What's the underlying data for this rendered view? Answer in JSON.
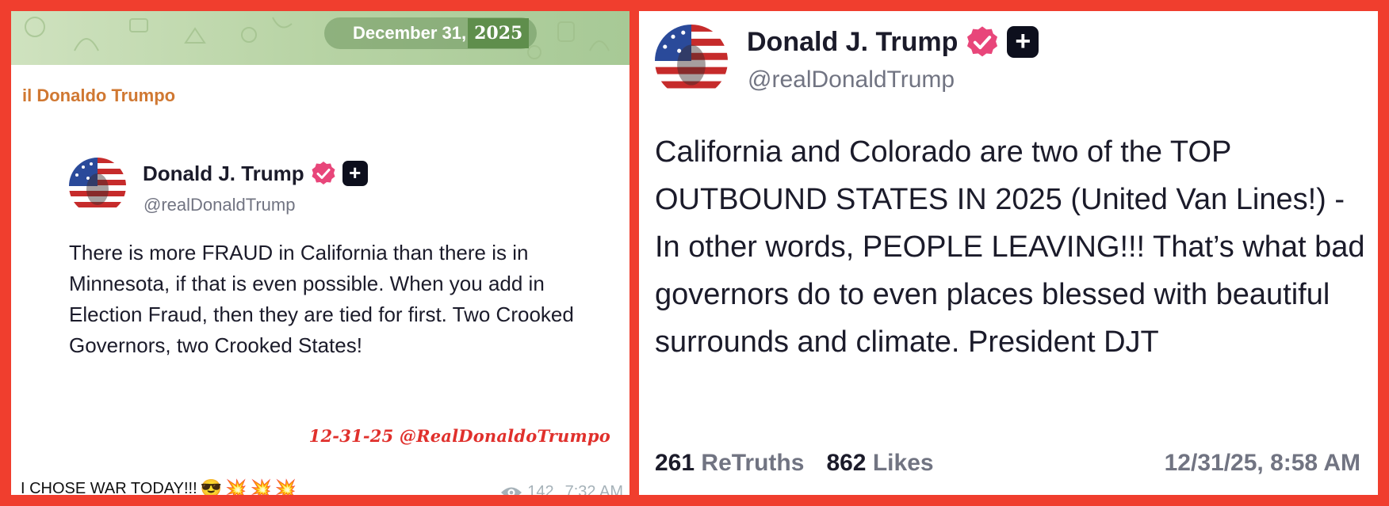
{
  "left": {
    "date_label": "December 31,",
    "date_year": "2025",
    "sender": "il Donaldo Trumpo",
    "post": {
      "name": "Donald J. Trump",
      "handle": "@realDonaldTrump",
      "text": "There is more FRAUD in California than there is in Minnesota, if that is even possible. When you add in Election Fraud, then they are tied for first. Two Crooked Governors, two Crooked States!"
    },
    "signature": "12-31-25 @RealDonaldoTrumpo",
    "caption": "I CHOSE WAR TODAY!!!",
    "caption_emojis": [
      "😎",
      "💥",
      "💥",
      "💥"
    ],
    "views": "142",
    "time": "7:32 AM"
  },
  "right": {
    "name": "Donald J. Trump",
    "handle": "@realDonaldTrump",
    "text": "California and Colorado are two of the TOP OUTBOUND STATES IN 2025 (United Van Lines!) - In other words, PEOPLE LEAVING!!! That’s what bad governors do to even places blessed with beautiful surrounds and climate. President DJT",
    "retruths_count": "261",
    "retruths_label": "ReTruths",
    "likes_count": "862",
    "likes_label": "Likes",
    "timestamp": "12/31/25, 8:58 AM"
  },
  "colors": {
    "frame": "#f03e2e",
    "sender": "#d07832",
    "signature": "#e0302c",
    "verified": "#e8467a",
    "text": "#1b1b2a",
    "muted": "#717482"
  },
  "icons": [
    "verified-badge-icon",
    "plus-badge-icon",
    "eye-icon"
  ]
}
